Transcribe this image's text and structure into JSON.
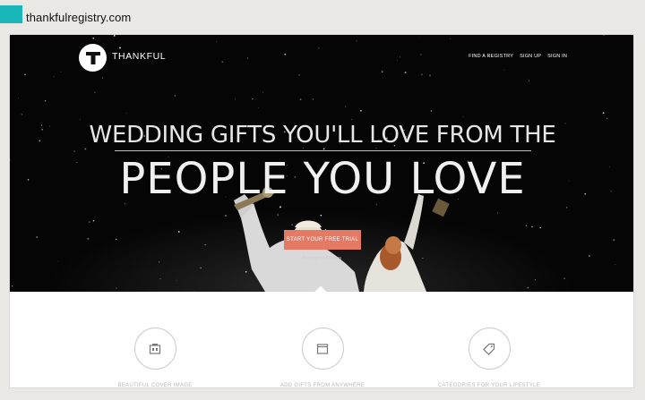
{
  "browser": {
    "url": "thankfulregistry.com"
  },
  "header": {
    "logo_letter": "T",
    "brand": "THANKFUL",
    "nav": [
      "FIND A REGISTRY",
      "SIGN UP",
      "SIGN IN"
    ]
  },
  "hero": {
    "headline_line1": "WEDDING GIFTS YOU'LL LOVE FROM THE",
    "headline_line2": "PEOPLE YOU LOVE",
    "cta_label": "START YOUR FREE TRIAL",
    "cta_subtext": "& congratulations"
  },
  "features": [
    {
      "label": "BEAUTIFUL COVER IMAGE",
      "icon": "cover-image-icon"
    },
    {
      "label": "ADD GIFTS FROM ANYWHERE",
      "icon": "browser-window-icon"
    },
    {
      "label": "CATEGORIES FOR YOUR LIFESTYLE",
      "icon": "tag-icon"
    }
  ],
  "colors": {
    "accent_tab": "#1ab6b8",
    "cta": "#e57a64",
    "hero_bg": "#050505"
  }
}
